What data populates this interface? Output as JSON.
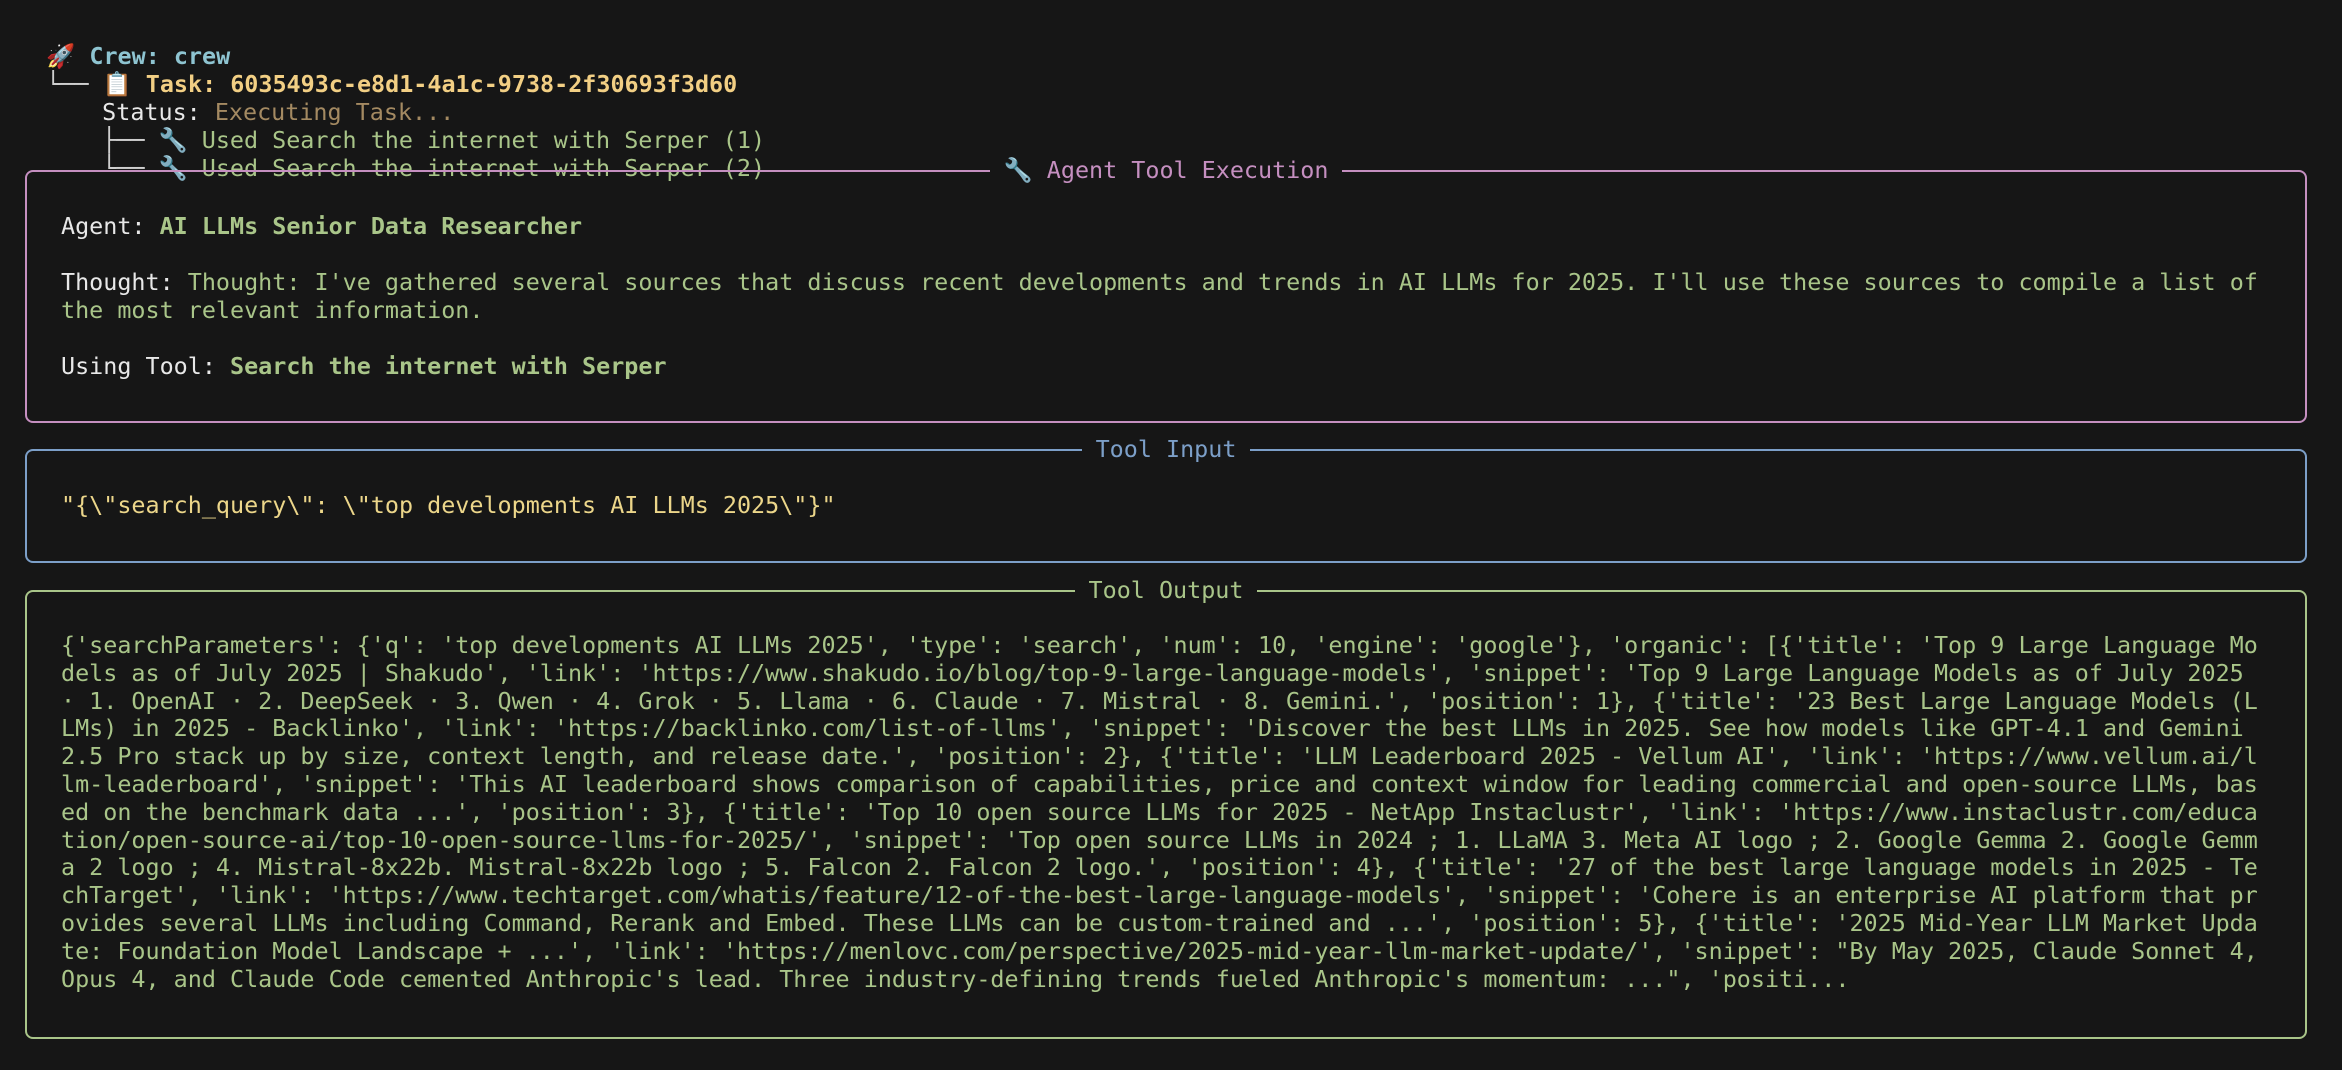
{
  "tree": {
    "crew_icon": "🚀",
    "crew_label": "Crew: crew",
    "branch1": "└── ",
    "task_icon": "📋",
    "task_label": "Task: 6035493c-e8d1-4a1c-9738-2f30693f3d60",
    "status_label": "Status: ",
    "status_value": "Executing Task...",
    "tools": [
      {
        "branch": "├── ",
        "icon": "🔧",
        "label": "Used Search the internet with Serper (1)"
      },
      {
        "branch": "└── ",
        "icon": "🔧",
        "label": "Used Search the internet with Serper (2)"
      }
    ]
  },
  "agent_panel": {
    "title_icon": "🔧",
    "title": "Agent Tool Execution",
    "agent_label": "Agent: ",
    "agent_value": "AI LLMs Senior Data Researcher",
    "thought_label": "Thought: ",
    "thought_value": "Thought: I've gathered several sources that discuss recent developments and trends in AI LLMs for 2025. I'll use these sources to compile a list of the most relevant information.",
    "tool_label": "Using Tool: ",
    "tool_value": "Search the internet with Serper"
  },
  "input_panel": {
    "title": "Tool Input",
    "value": "\"{\\\"search_query\\\": \\\"top developments AI LLMs 2025\\\"}\""
  },
  "output_panel": {
    "title": "Tool Output",
    "value": "{'searchParameters': {'q': 'top developments AI LLMs 2025', 'type': 'search', 'num': 10, 'engine': 'google'}, 'organic': [{'title': 'Top 9 Large Language Models as of July 2025 | Shakudo', 'link': 'https://www.shakudo.io/blog/top-9-large-language-models', 'snippet': 'Top 9 Large Language Models as of July 2025 · 1. OpenAI · 2. DeepSeek · 3. Qwen · 4. Grok · 5. Llama · 6. Claude · 7. Mistral · 8. Gemini.', 'position': 1}, {'title': '23 Best Large Language Models (LLMs) in 2025 - Backlinko', 'link': 'https://backlinko.com/list-of-llms', 'snippet': 'Discover the best LLMs in 2025. See how models like GPT-4.1 and Gemini 2.5 Pro stack up by size, context length, and release date.', 'position': 2}, {'title': 'LLM Leaderboard 2025 - Vellum AI', 'link': 'https://www.vellum.ai/llm-leaderboard', 'snippet': 'This AI leaderboard shows comparison of capabilities, price and context window for leading commercial and open-source LLMs, based on the benchmark data ...', 'position': 3}, {'title': 'Top 10 open source LLMs for 2025 - NetApp Instaclustr', 'link': 'https://www.instaclustr.com/education/open-source-ai/top-10-open-source-llms-for-2025/', 'snippet': 'Top open source LLMs in 2024 ; 1. LLaMA 3. Meta AI logo ; 2. Google Gemma 2. Google Gemma 2 logo ; 4. Mistral-8x22b. Mistral-8x22b logo ; 5. Falcon 2. Falcon 2 logo.', 'position': 4}, {'title': '27 of the best large language models in 2025 - TechTarget', 'link': 'https://www.techtarget.com/whatis/feature/12-of-the-best-large-language-models', 'snippet': 'Cohere is an enterprise AI platform that provides several LLMs including Command, Rerank and Embed. These LLMs can be custom-trained and ...', 'position': 5}, {'title': '2025 Mid-Year LLM Market Update: Foundation Model Landscape + ...', 'link': 'https://menlovc.com/perspective/2025-mid-year-llm-market-update/', 'snippet': \"By May 2025, Claude Sonnet 4, Opus 4, and Claude Code cemented Anthropic's lead. Three industry-defining trends fueled Anthropic's momentum: ...\", 'positi..."
  },
  "colors": {
    "background": "#161616",
    "agent_border": "#c58fc0",
    "input_border": "#7c9fc8",
    "output_border": "#a9c589",
    "green": "#a9c589",
    "yellow": "#ecd68a",
    "cyan": "#8ec4d1",
    "tan": "#a48a62"
  }
}
